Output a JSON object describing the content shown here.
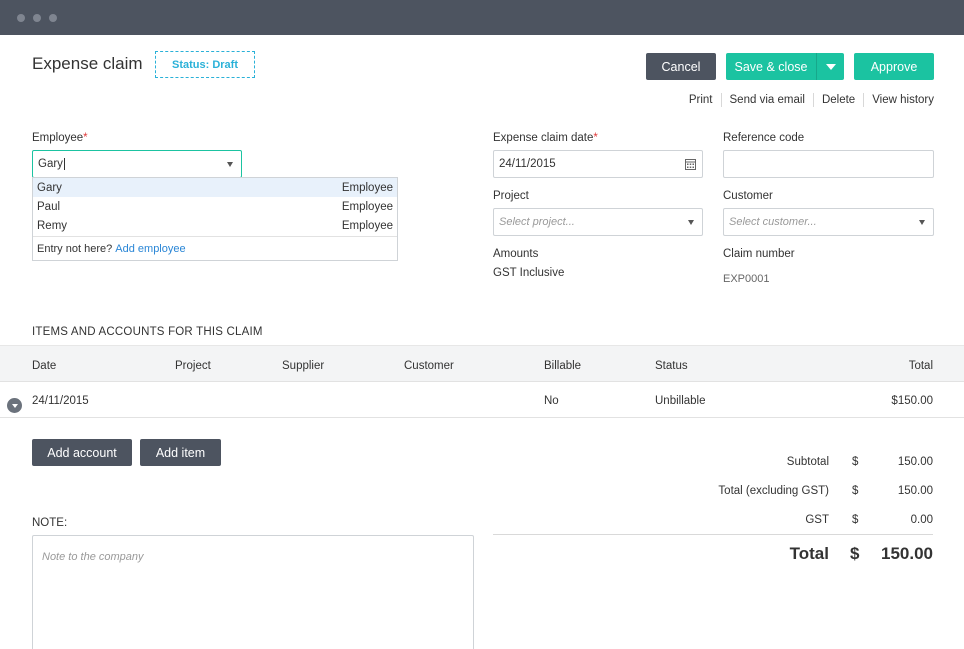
{
  "header": {
    "title": "Expense claim",
    "status": "Status: Draft"
  },
  "actions": {
    "cancel": "Cancel",
    "save_close": "Save & close",
    "approve": "Approve",
    "links": [
      "Print",
      "Send via email",
      "Delete",
      "View history"
    ]
  },
  "form": {
    "employee": {
      "label": "Employee",
      "required_mark": "*",
      "value": "Gary",
      "options": [
        {
          "name": "Gary",
          "type": "Employee",
          "highlighted": true
        },
        {
          "name": "Paul",
          "type": "Employee",
          "highlighted": false
        },
        {
          "name": "Remy",
          "type": "Employee",
          "highlighted": false
        }
      ],
      "footer_text": "Entry not here?",
      "footer_link": "Add employee"
    },
    "claim_date": {
      "label": "Expense claim date",
      "required_mark": "*",
      "value": "24/11/2015"
    },
    "reference": {
      "label": "Reference code",
      "value": ""
    },
    "project": {
      "label": "Project",
      "placeholder": "Select project..."
    },
    "customer": {
      "label": "Customer",
      "placeholder": "Select customer..."
    },
    "amounts": {
      "label": "Amounts",
      "value": "GST Inclusive"
    },
    "claim_number": {
      "label": "Claim number",
      "value": "EXP0001"
    }
  },
  "items": {
    "section_title": "ITEMS AND ACCOUNTS FOR THIS CLAIM",
    "columns": [
      "Date",
      "Project",
      "Supplier",
      "Customer",
      "Billable",
      "Status",
      "Total"
    ],
    "rows": [
      {
        "date": "24/11/2015",
        "project": "",
        "supplier": "",
        "customer": "",
        "billable": "No",
        "status": "Unbillable",
        "total": "$150.00"
      }
    ],
    "add_account": "Add account",
    "add_item": "Add item"
  },
  "totals": {
    "currency": "$",
    "subtotal_label": "Subtotal",
    "subtotal": "150.00",
    "excl_label": "Total (excluding GST)",
    "excl": "150.00",
    "gst_label": "GST",
    "gst": "0.00",
    "total_label": "Total",
    "total": "150.00"
  },
  "note": {
    "label": "NOTE:",
    "placeholder": "Note to the company"
  },
  "colors": {
    "accent_green": "#1bc3a1",
    "dark_button": "#4d5460",
    "link_blue": "#2a86d6",
    "status_blue": "#2ab1d8"
  }
}
